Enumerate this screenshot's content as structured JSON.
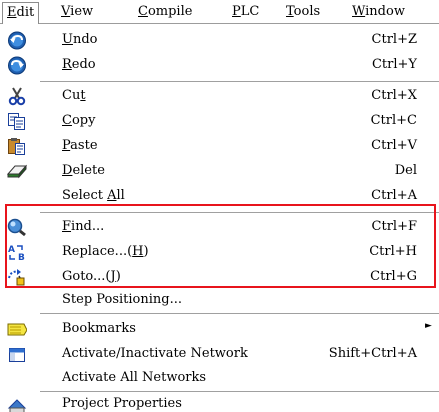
{
  "menubar": {
    "items": [
      {
        "label": "Edit",
        "ul": "E",
        "rest": "dit"
      },
      {
        "label": "View",
        "ul": "V",
        "rest": "iew"
      },
      {
        "label": "Compile",
        "ul": "C",
        "rest": "ompile"
      },
      {
        "label": "PLC",
        "ul": "P",
        "rest": "LC"
      },
      {
        "label": "Tools",
        "ul": "T",
        "rest": "ools"
      },
      {
        "label": "Window",
        "ul": "W",
        "rest": "indow"
      }
    ]
  },
  "menu": {
    "items": [
      {
        "pre": "",
        "ul": "U",
        "post": "ndo",
        "shortcut": "Ctrl+Z",
        "icon": "undo-icon"
      },
      {
        "pre": "",
        "ul": "R",
        "post": "edo",
        "shortcut": "Ctrl+Y",
        "icon": "redo-icon"
      },
      {
        "pre": "Cu",
        "ul": "t",
        "post": "",
        "shortcut": "Ctrl+X",
        "icon": "scissors-icon"
      },
      {
        "pre": "",
        "ul": "C",
        "post": "opy",
        "shortcut": "Ctrl+C",
        "icon": "copy-icon"
      },
      {
        "pre": "",
        "ul": "P",
        "post": "aste",
        "shortcut": "Ctrl+V",
        "icon": "paste-icon"
      },
      {
        "pre": "",
        "ul": "D",
        "post": "elete",
        "shortcut": "Del",
        "icon": "eraser-icon"
      },
      {
        "pre": "Select ",
        "ul": "A",
        "post": "ll",
        "shortcut": "Ctrl+A",
        "icon": ""
      },
      {
        "pre": "",
        "ul": "F",
        "post": "ind...",
        "shortcut": "Ctrl+F",
        "icon": "magnifier-icon"
      },
      {
        "pre": "Replace...(",
        "ul": "H",
        "post": ")",
        "shortcut": "Ctrl+H",
        "icon": "replace-icon"
      },
      {
        "pre": "Goto...(",
        "ul": "J",
        "post": ")",
        "shortcut": "Ctrl+G",
        "icon": "goto-icon"
      },
      {
        "pre": "Step Positioning...",
        "ul": "",
        "post": "",
        "shortcut": "",
        "icon": ""
      },
      {
        "pre": "Bookmarks",
        "ul": "",
        "post": "",
        "shortcut": "",
        "icon": "bookmark-icon"
      },
      {
        "pre": "Activate/Inactivate Network",
        "ul": "",
        "post": "",
        "shortcut": "Shift+Ctrl+A",
        "icon": "network-icon"
      },
      {
        "pre": "Activate All Networks",
        "ul": "",
        "post": "",
        "shortcut": "",
        "icon": ""
      },
      {
        "pre": "Project Properties",
        "ul": "",
        "post": "",
        "shortcut": "",
        "icon": "properties-icon"
      }
    ],
    "submenu_arrow": "►",
    "colors": {
      "highlight_border": "#e8141c",
      "separator": "#a0a0a0"
    }
  }
}
